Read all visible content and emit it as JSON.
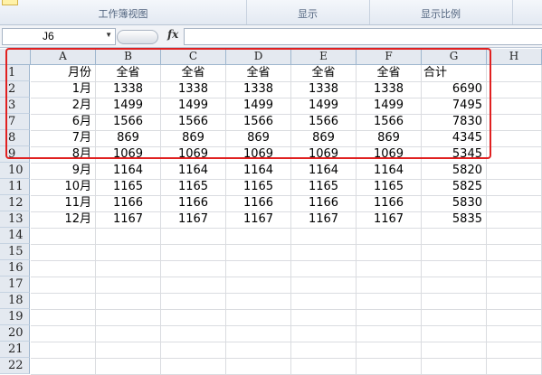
{
  "ribbon": {
    "groups": [
      {
        "label": "工作簿视图"
      },
      {
        "label": "显示"
      },
      {
        "label": "显示比例"
      }
    ]
  },
  "formula_bar": {
    "name_box": "J6",
    "fx_label": "fx",
    "formula": ""
  },
  "columns": [
    "A",
    "B",
    "C",
    "D",
    "E",
    "F",
    "G",
    "H"
  ],
  "rows": [
    {
      "num": "1",
      "cells": [
        "月份",
        "全省",
        "全省",
        "全省",
        "全省",
        "全省",
        "合计"
      ]
    },
    {
      "num": "2",
      "cells": [
        "1月",
        "1338",
        "1338",
        "1338",
        "1338",
        "1338",
        "6690"
      ]
    },
    {
      "num": "3",
      "cells": [
        "2月",
        "1499",
        "1499",
        "1499",
        "1499",
        "1499",
        "7495"
      ]
    },
    {
      "num": "7",
      "cells": [
        "6月",
        "1566",
        "1566",
        "1566",
        "1566",
        "1566",
        "7830"
      ]
    },
    {
      "num": "8",
      "cells": [
        "7月",
        "869",
        "869",
        "869",
        "869",
        "869",
        "4345"
      ]
    },
    {
      "num": "9",
      "cells": [
        "8月",
        "1069",
        "1069",
        "1069",
        "1069",
        "1069",
        "5345"
      ]
    },
    {
      "num": "10",
      "cells": [
        "9月",
        "1164",
        "1164",
        "1164",
        "1164",
        "1164",
        "5820"
      ]
    },
    {
      "num": "11",
      "cells": [
        "10月",
        "1165",
        "1165",
        "1165",
        "1165",
        "1165",
        "5825"
      ]
    },
    {
      "num": "12",
      "cells": [
        "11月",
        "1166",
        "1166",
        "1166",
        "1166",
        "1166",
        "5830"
      ]
    },
    {
      "num": "13",
      "cells": [
        "12月",
        "1167",
        "1167",
        "1167",
        "1167",
        "1167",
        "5835"
      ]
    },
    {
      "num": "14",
      "cells": [
        "",
        "",
        "",
        "",
        "",
        "",
        ""
      ]
    },
    {
      "num": "15",
      "cells": [
        "",
        "",
        "",
        "",
        "",
        "",
        ""
      ]
    },
    {
      "num": "16",
      "cells": [
        "",
        "",
        "",
        "",
        "",
        "",
        ""
      ]
    },
    {
      "num": "17",
      "cells": [
        "",
        "",
        "",
        "",
        "",
        "",
        ""
      ]
    },
    {
      "num": "18",
      "cells": [
        "",
        "",
        "",
        "",
        "",
        "",
        ""
      ]
    },
    {
      "num": "19",
      "cells": [
        "",
        "",
        "",
        "",
        "",
        "",
        ""
      ]
    },
    {
      "num": "20",
      "cells": [
        "",
        "",
        "",
        "",
        "",
        "",
        ""
      ]
    },
    {
      "num": "21",
      "cells": [
        "",
        "",
        "",
        "",
        "",
        "",
        ""
      ]
    },
    {
      "num": "22",
      "cells": [
        "",
        "",
        "",
        "",
        "",
        "",
        ""
      ]
    }
  ],
  "colors": {
    "highlight": "#e02020",
    "header_bg": "#e4e9f0"
  }
}
